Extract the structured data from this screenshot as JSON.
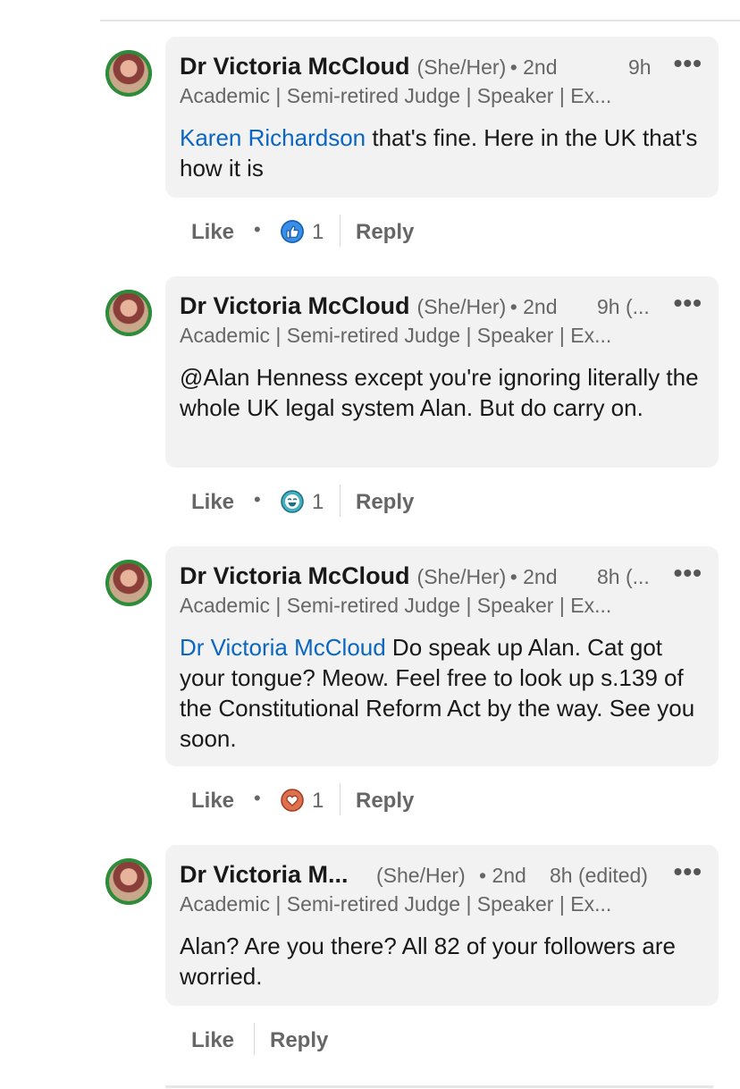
{
  "comments": [
    {
      "author": "Dr Victoria McCloud",
      "pronouns": "(She/Her)",
      "degree": "• 2nd",
      "time": "9h",
      "headline": "Academic | Semi-retired Judge | Speaker | Ex...",
      "mention": "Karen Richardson",
      "text": " that's fine. Here in the UK that's how it is",
      "like_label": "Like",
      "reaction_icon": "thumbs-up-icon",
      "reaction_count": "1",
      "reply_label": "Reply"
    },
    {
      "author": "Dr Victoria McCloud",
      "pronouns": "(She/Her)",
      "degree": "• 2nd",
      "time": "9h (...",
      "headline": "Academic | Semi-retired Judge | Speaker | Ex...",
      "mention": "",
      "text": "@Alan Henness except you're ignoring literally the whole UK legal system Alan. But do carry on.",
      "like_label": "Like",
      "reaction_icon": "funny-face-icon",
      "reaction_count": "1",
      "reply_label": "Reply"
    },
    {
      "author": "Dr Victoria McCloud",
      "pronouns": "(She/Her)",
      "degree": "• 2nd",
      "time": "8h (...",
      "headline": "Academic | Semi-retired Judge | Speaker | Ex...",
      "mention": "Dr Victoria McCloud",
      "text": " Do speak up Alan. Cat got your tongue? Meow. Feel free to look up s.139 of the Constitutional Reform Act by the way. See you soon.",
      "like_label": "Like",
      "reaction_icon": "heart-icon",
      "reaction_count": "1",
      "reply_label": "Reply"
    },
    {
      "author": "Dr Victoria M...",
      "pronouns": "(She/Her)",
      "degree": "• 2nd",
      "time": "8h (edited)",
      "headline": "Academic | Semi-retired Judge | Speaker | Ex...",
      "mention": "",
      "text": "Alan? Are you there? All 82 of your followers are worried.",
      "like_label": "Like",
      "reaction_icon": "",
      "reaction_count": "",
      "reply_label": "Reply"
    }
  ],
  "more_label": "•••",
  "colors": {
    "link": "#0a66c2",
    "bubble": "#f2f2f2",
    "like_blue": "#378fe9",
    "celebrate_teal": "#44b0c4",
    "love_red": "#df704d"
  }
}
